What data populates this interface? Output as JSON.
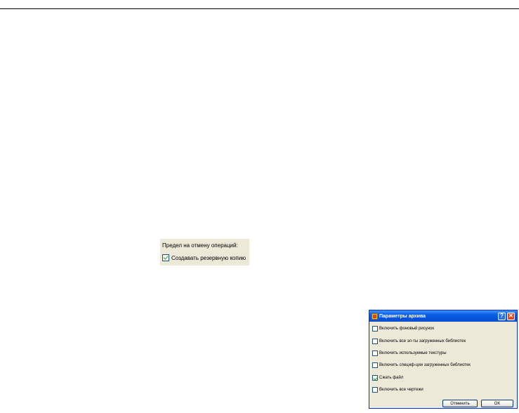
{
  "options_snippet": {
    "undo_limit_label": "Предел на отмену операций:",
    "backup_label": "Создавать резервную копию",
    "backup_checked": true
  },
  "archive_dialog": {
    "title": "Параметры архива",
    "help_label": "?",
    "close_label": "✕",
    "options": [
      {
        "label": "Включить фоновый рисунок",
        "checked": false
      },
      {
        "label": "Включить все эл-ты загруженных библиотек",
        "checked": false
      },
      {
        "label": "Включить используемые текстуры",
        "checked": false
      },
      {
        "label": "Включить специф-ции загруженных библиотек",
        "checked": false
      },
      {
        "label": "Сжать файл",
        "checked": true
      },
      {
        "label": "Включить все чертежи",
        "checked": false
      }
    ],
    "cancel_label": "Отменить",
    "ok_label": "OK"
  },
  "colors": {
    "dialog_face": "#ece9d8",
    "titlebar": "#0554dd",
    "check_mark": "#21a121"
  }
}
